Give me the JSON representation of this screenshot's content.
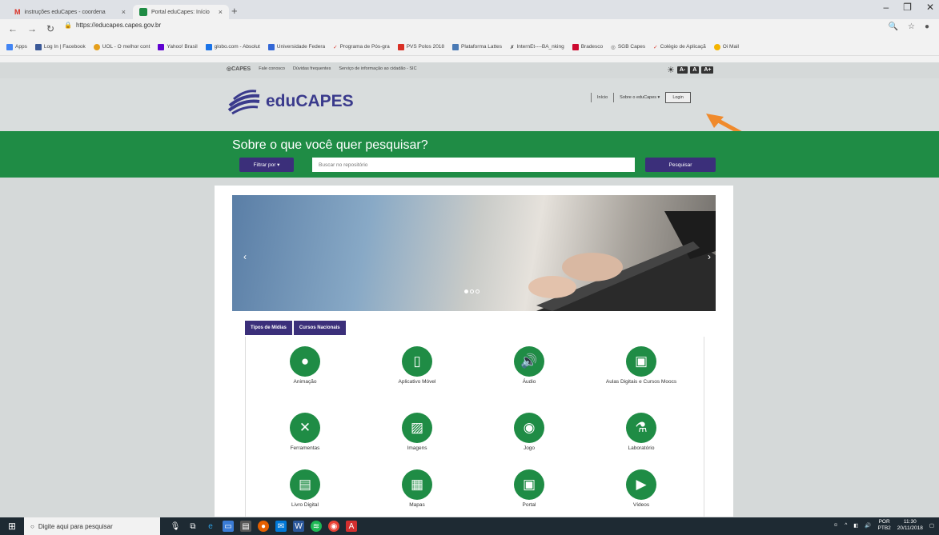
{
  "browser": {
    "tabs": [
      {
        "label": "instruções eduCapes - coordena",
        "close": "×"
      },
      {
        "label": "Portal eduCapes: Início",
        "close": "×"
      }
    ],
    "new_tab": "+",
    "window_controls": [
      "–",
      "❐",
      "✕"
    ],
    "url": "https://educapes.capes.gov.br",
    "bookmarks": [
      "Apps",
      "Log In | Facebook",
      "UOL - O melhor cont",
      "Yahoo! Brasil",
      "globo.com - Absolut",
      "Universidade Federa",
      "Programa de Pós-gra",
      "PVS Polos 2018",
      "Plataforma Lattes",
      "InternEt----BA_nking",
      "Bradesco",
      "SGB Capes",
      "Colégio de Aplicaçã",
      "Oi Mail"
    ]
  },
  "gov_bar": {
    "capes": "CAPES",
    "links": [
      "Fale conosco",
      "Dúvidas frequentes",
      "Serviço de informação ao cidadão - SIC"
    ],
    "accessibility": [
      "A-",
      "A",
      "A+"
    ]
  },
  "header": {
    "logo_text": "eduCAPES",
    "nav": [
      "Início",
      "Sobre o eduCapes ▾"
    ],
    "login": "Login"
  },
  "search": {
    "question": "Sobre o que você quer pesquisar?",
    "filter_label": "Filtrar por ▾",
    "placeholder": "Buscar no repositório",
    "button": "Pesquisar"
  },
  "media_tabs": [
    "Tipos de Mídias",
    "Cursos Nacionais"
  ],
  "media_types": [
    {
      "label": "Animação",
      "icon": "animation-icon"
    },
    {
      "label": "Aplicativo Móvel",
      "icon": "mobile-app-icon"
    },
    {
      "label": "Áudio",
      "icon": "audio-icon"
    },
    {
      "label": "Aulas Digitais e Cursos Moocs",
      "icon": "digital-class-icon"
    },
    {
      "label": "Ferramentas",
      "icon": "tools-icon"
    },
    {
      "label": "Imagens",
      "icon": "image-icon"
    },
    {
      "label": "Jogo",
      "icon": "game-icon"
    },
    {
      "label": "Laboratório",
      "icon": "lab-icon"
    },
    {
      "label": "Livro Digital",
      "icon": "ebook-icon"
    },
    {
      "label": "Mapas",
      "icon": "map-icon"
    },
    {
      "label": "Portal",
      "icon": "portal-icon"
    },
    {
      "label": "Vídeos",
      "icon": "video-icon"
    }
  ],
  "taskbar": {
    "search_placeholder": "Digite aqui para pesquisar",
    "lang1": "POR",
    "lang2": "PTB2",
    "time": "11:30",
    "date": "20/11/2018"
  },
  "colors": {
    "green": "#1f8c45",
    "purple": "#3b2f7a",
    "arrow": "#f08a2c"
  }
}
